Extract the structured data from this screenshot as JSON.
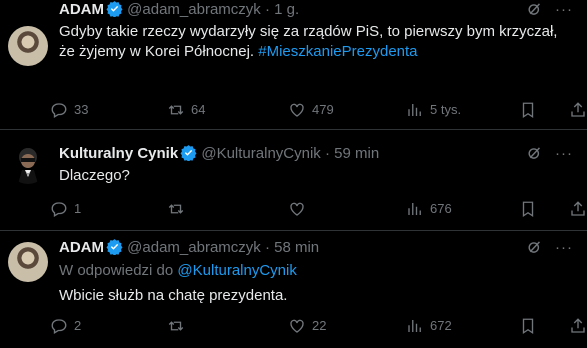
{
  "tweets": [
    {
      "name": "ADAM",
      "handle": "@adam_abramczyk",
      "sep": "·",
      "time": "1 g.",
      "text_line1": "Gdyby takie rzeczy wydarzyły się za rządów PiS, to pierwszy bym krzyczał,",
      "text_line2": "że żyjemy w Korei Północnej.",
      "hashtag": "#MieszkaniePrezydenta",
      "replies": "33",
      "retweets": "64",
      "likes": "479",
      "views": "5 tys."
    },
    {
      "name": "Kulturalny Cynik",
      "handle": "@KulturalnyCynik",
      "sep": "·",
      "time": "59 min",
      "text": "Dlaczego?",
      "replies": "1",
      "retweets": "",
      "likes": "",
      "views": "676"
    },
    {
      "name": "ADAM",
      "handle": "@adam_abramczyk",
      "sep": "·",
      "time": "58 min",
      "reply_prefix": "W odpowiedzi do",
      "reply_mention": "@KulturalnyCynik",
      "text": "Wbicie służb na chatę prezydenta.",
      "replies": "2",
      "retweets": "",
      "likes": "22",
      "views": "672"
    }
  ],
  "more_label": "···",
  "colors": {
    "accent": "#1d9bf0",
    "muted": "#71767b",
    "text": "#e7e9ea",
    "bg": "#000000"
  },
  "icons": [
    "verified-badge-icon",
    "grok-icon",
    "more-icon",
    "reply-icon",
    "retweet-icon",
    "like-icon",
    "views-icon",
    "bookmark-icon",
    "share-icon"
  ]
}
